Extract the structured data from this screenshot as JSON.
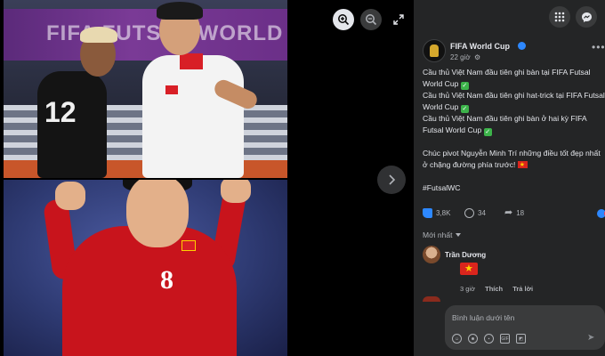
{
  "viewer": {
    "top_photo": {
      "banner_text": "FIFA FUTSAL WORLD",
      "jersey_number": "12"
    },
    "bottom_photo": {
      "jersey_number": "8"
    }
  },
  "post": {
    "page_name": "FIFA World Cup",
    "time": "22 giờ",
    "lines": [
      "Cầu thủ Việt Nam đầu tiên ghi bàn tại FIFA Futsal World Cup",
      "Cầu thủ Việt Nam đầu tiên ghi hat-trick tại FIFA Futsal World Cup",
      "Cầu thủ Việt Nam đầu tiên ghi bàn ở hai kỳ FIFA Futsal World Cup"
    ],
    "wish": "Chúc pivot Nguyễn Minh Trí những điều tốt đẹp nhất ở chặng đường phía trước!",
    "hashtag": "#FutsalWC",
    "likes": "3,8K",
    "comments": "34",
    "shares": "18",
    "sort_label": "Mới nhất"
  },
  "comment": {
    "author": "Trần Dương",
    "time": "3 giờ",
    "like_label": "Thích",
    "reply_label": "Trả lời"
  },
  "composer": {
    "placeholder": "Bình luận dưới tên"
  },
  "colors": {
    "panel_bg": "#242526",
    "accent": "#2d88ff",
    "check": "#3cb34a",
    "vn_red": "#da251d"
  }
}
